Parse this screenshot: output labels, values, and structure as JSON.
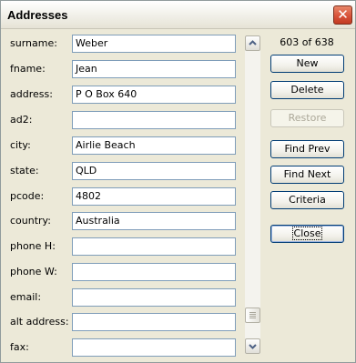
{
  "window": {
    "title": "Addresses",
    "close_glyph": "✕"
  },
  "fields": [
    {
      "label": "surname:",
      "value": "Weber"
    },
    {
      "label": "fname:",
      "value": "Jean"
    },
    {
      "label": "address:",
      "value": "P O Box 640"
    },
    {
      "label": "ad2:",
      "value": ""
    },
    {
      "label": "city:",
      "value": "Airlie Beach"
    },
    {
      "label": "state:",
      "value": "QLD"
    },
    {
      "label": "pcode:",
      "value": "4802"
    },
    {
      "label": "country:",
      "value": "Australia"
    },
    {
      "label": "phone H:",
      "value": ""
    },
    {
      "label": "phone W:",
      "value": ""
    },
    {
      "label": "email:",
      "value": ""
    },
    {
      "label": "alt address:",
      "value": ""
    },
    {
      "label": "fax:",
      "value": ""
    }
  ],
  "record": {
    "count_text": "603 of 638"
  },
  "buttons": {
    "new": "New",
    "delete": "Delete",
    "restore": "Restore",
    "find_prev": "Find Prev",
    "find_next": "Find Next",
    "criteria": "Criteria",
    "close": "Close"
  },
  "scrollbar": {
    "up_icon": "chevron-up-icon",
    "down_icon": "chevron-down-icon"
  }
}
